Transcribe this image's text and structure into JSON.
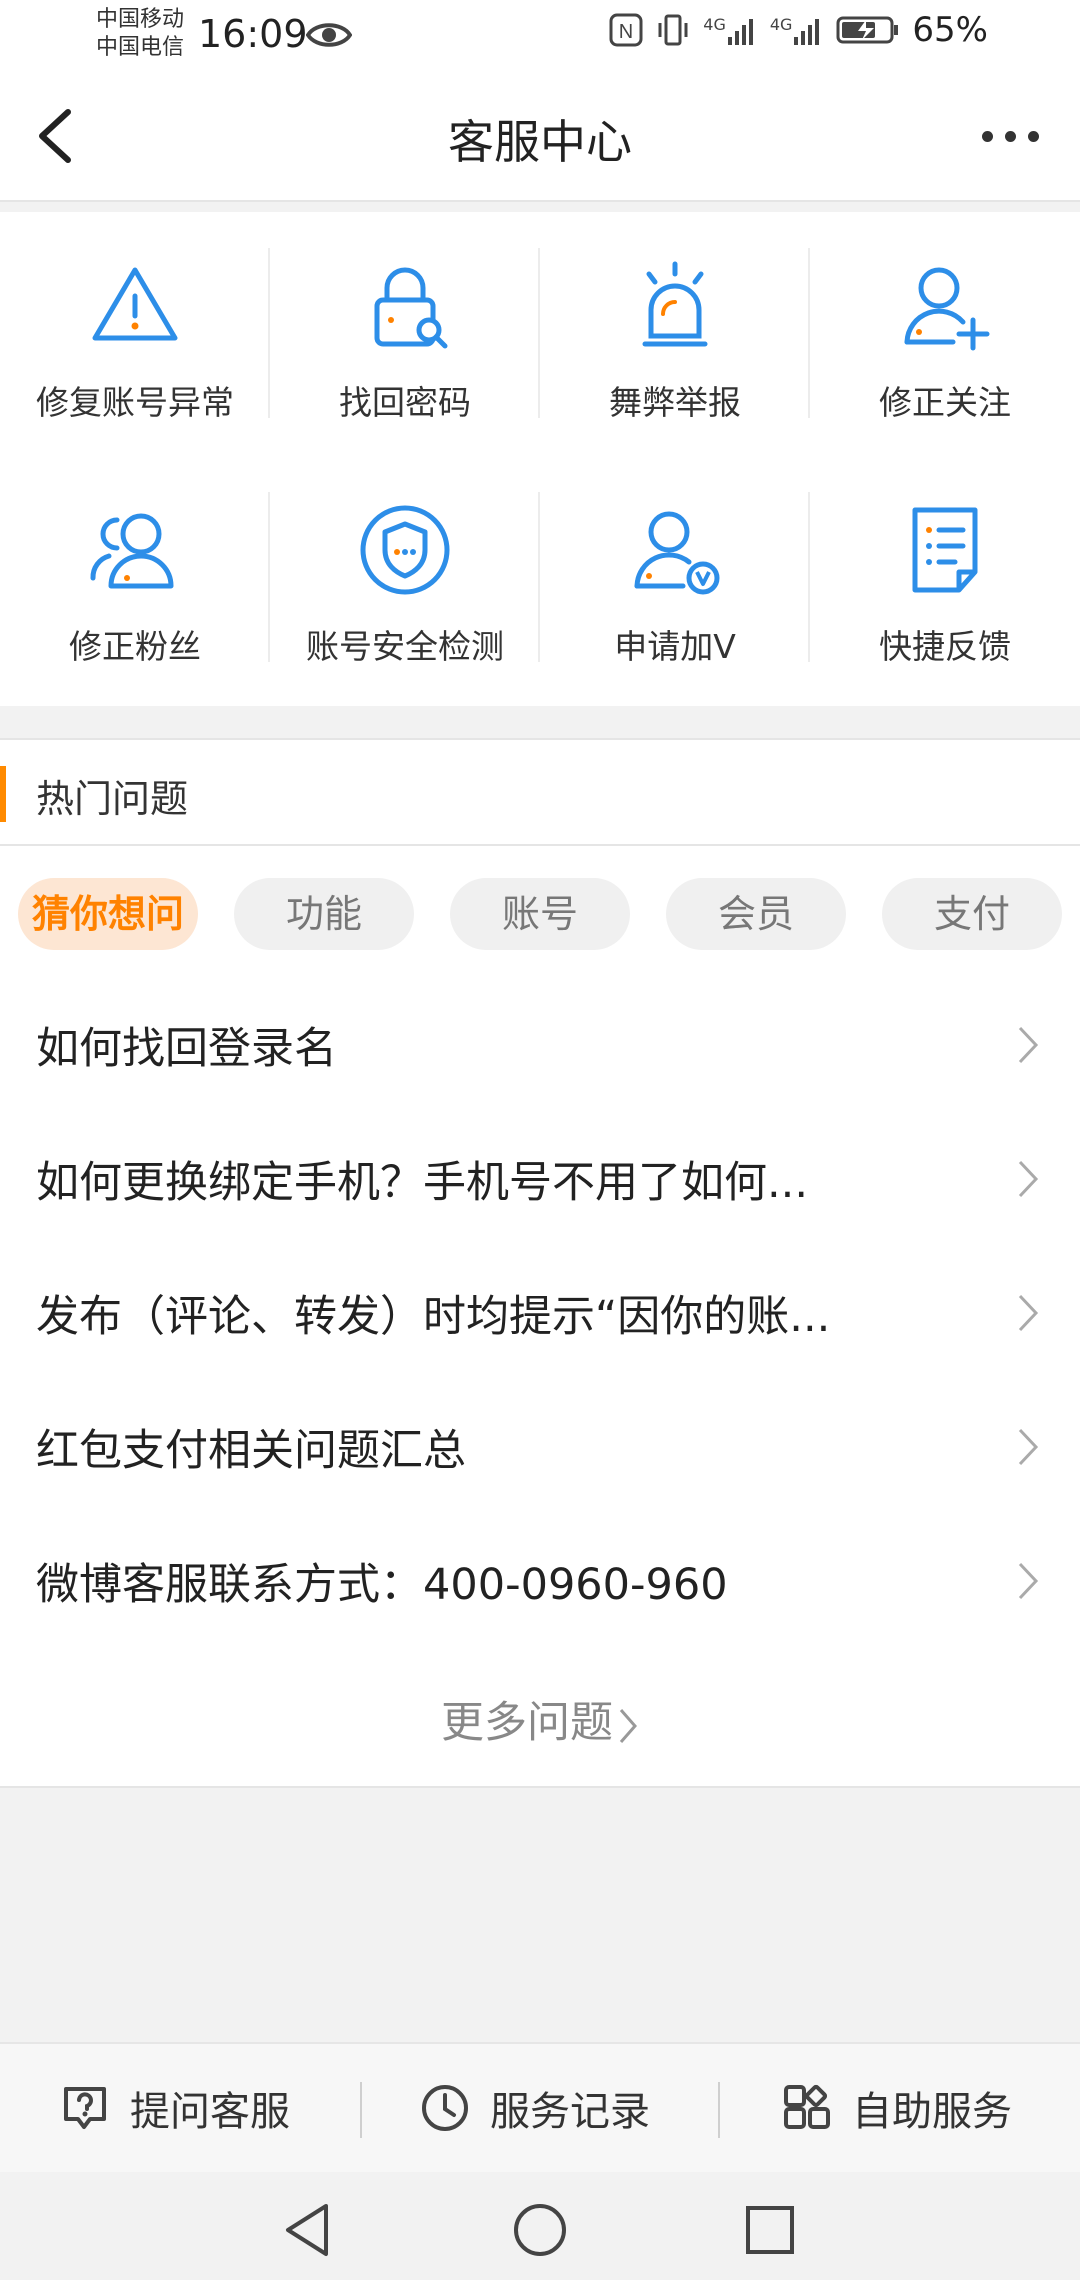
{
  "status_bar": {
    "carrier_1": "中国移动",
    "carrier_2": "中国电信",
    "time": "16:09",
    "network_1": "4G",
    "network_2": "4G",
    "battery": "65%"
  },
  "header": {
    "title": "客服中心"
  },
  "services": [
    {
      "label": "修复账号异常",
      "icon": "warning-icon"
    },
    {
      "label": "找回密码",
      "icon": "lock-icon"
    },
    {
      "label": "舞弊举报",
      "icon": "alarm-icon"
    },
    {
      "label": "修正关注",
      "icon": "add-user-icon"
    },
    {
      "label": "修正粉丝",
      "icon": "fans-icon"
    },
    {
      "label": "账号安全检测",
      "icon": "shield-icon"
    },
    {
      "label": "申请加V",
      "icon": "verified-user-icon"
    },
    {
      "label": "快捷反馈",
      "icon": "feedback-icon"
    }
  ],
  "hot": {
    "title": "热门问题",
    "tabs": [
      "猜你想问",
      "功能",
      "账号",
      "会员",
      "支付"
    ],
    "questions": [
      "如何找回登录名",
      "如何更换绑定手机？手机号不用了如何...",
      "发布（评论、转发）时均提示“因你的账...",
      "红包支付相关问题汇总",
      "微博客服联系方式：400-0960-960"
    ],
    "more": "更多问题"
  },
  "bottom_bar": {
    "ask": "提问客服",
    "records": "服务记录",
    "self_service": "自助服务"
  },
  "colors": {
    "accent": "#ff8200",
    "icon_blue": "#2d8ee8"
  }
}
